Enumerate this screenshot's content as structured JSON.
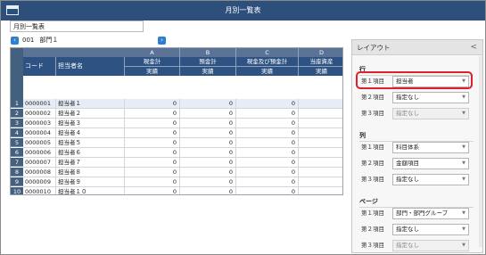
{
  "window": {
    "title": "月別一覧表"
  },
  "report": {
    "name_value": "月別一覧表",
    "dept_code": "001",
    "dept_name": "部門１"
  },
  "grid": {
    "col_letters": [
      "A",
      "B",
      "C",
      "D"
    ],
    "fixed_headers": [
      "コード",
      "担当者名"
    ],
    "columns": [
      {
        "top": "現金計",
        "sub": "実績"
      },
      {
        "top": "預金計",
        "sub": "実績"
      },
      {
        "top": "現金及び預金計",
        "sub": "実績"
      },
      {
        "top": "当座資産",
        "sub": "実績"
      }
    ],
    "rows": [
      {
        "num": "1",
        "code": "0000001",
        "name": "担当者１",
        "values": [
          "0",
          "0",
          "0",
          ""
        ]
      },
      {
        "num": "2",
        "code": "0000002",
        "name": "担当者２",
        "values": [
          "0",
          "0",
          "0",
          ""
        ]
      },
      {
        "num": "3",
        "code": "0000003",
        "name": "担当者３",
        "values": [
          "0",
          "0",
          "0",
          ""
        ]
      },
      {
        "num": "4",
        "code": "0000004",
        "name": "担当者４",
        "values": [
          "0",
          "0",
          "0",
          ""
        ]
      },
      {
        "num": "5",
        "code": "0000005",
        "name": "担当者５",
        "values": [
          "0",
          "0",
          "0",
          ""
        ]
      },
      {
        "num": "6",
        "code": "0000006",
        "name": "担当者６",
        "values": [
          "0",
          "0",
          "0",
          ""
        ]
      },
      {
        "num": "7",
        "code": "0000007",
        "name": "担当者７",
        "values": [
          "0",
          "0",
          "0",
          ""
        ]
      },
      {
        "num": "8",
        "code": "0000008",
        "name": "担当者８",
        "values": [
          "0",
          "0",
          "0",
          ""
        ]
      },
      {
        "num": "9",
        "code": "0000009",
        "name": "担当者９",
        "values": [
          "0",
          "0",
          "0",
          ""
        ]
      },
      {
        "num": "10",
        "code": "0000010",
        "name": "担当者１０",
        "values": [
          "0",
          "0",
          "0",
          ""
        ]
      }
    ]
  },
  "layout_panel": {
    "title": "レイアウト",
    "collapse_glyph": "<",
    "sections": [
      {
        "label": "行",
        "items": [
          {
            "label": "第１項目",
            "value": "担当者",
            "disabled": false
          },
          {
            "label": "第２項目",
            "value": "指定なし",
            "disabled": false
          },
          {
            "label": "第３項目",
            "value": "指定なし",
            "disabled": true
          }
        ]
      },
      {
        "label": "列",
        "items": [
          {
            "label": "第１項目",
            "value": "科目体系",
            "disabled": false
          },
          {
            "label": "第２項目",
            "value": "金額項目",
            "disabled": false
          },
          {
            "label": "第３項目",
            "value": "指定なし",
            "disabled": false
          }
        ]
      },
      {
        "label": "ページ",
        "items": [
          {
            "label": "第１項目",
            "value": "部門・部門グループ",
            "disabled": false
          },
          {
            "label": "第２項目",
            "value": "指定なし",
            "disabled": false
          },
          {
            "label": "第３項目",
            "value": "指定なし",
            "disabled": true
          }
        ]
      }
    ]
  },
  "colors": {
    "titlebar": "#2c4f7c",
    "header": "#2e5382",
    "highlight": "#e0202a",
    "nav_button": "#2f7fd0"
  }
}
